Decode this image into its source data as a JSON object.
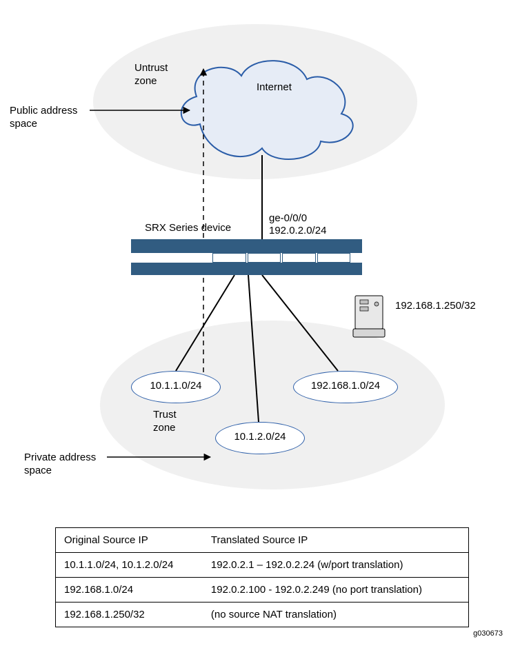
{
  "labels": {
    "public_addr_space": "Public address\nspace",
    "private_addr_space": "Private address\nspace",
    "untrust_zone": "Untrust\nzone",
    "trust_zone": "Trust\nzone",
    "internet": "Internet",
    "srx_device": "SRX Series device",
    "iface_name": "ge-0/0/0",
    "iface_addr": "192.0.2.0/24",
    "server_addr": "192.168.1.250/32"
  },
  "subnets": {
    "left": "10.1.1.0/24",
    "mid": "10.1.2.0/24",
    "right": "192.168.1.0/24"
  },
  "table": {
    "headers": {
      "orig": "Original Source IP",
      "trans": "Translated Source IP"
    },
    "rows": [
      {
        "orig": "10.1.1.0/24,  10.1.2.0/24",
        "trans": "192.0.2.1 – 192.0.2.24 (w/port translation)"
      },
      {
        "orig": "192.168.1.0/24",
        "trans": "192.0.2.100 - 192.0.2.249 (no port translation)"
      },
      {
        "orig": "192.168.1.250/32",
        "trans": "(no source NAT translation)"
      }
    ]
  },
  "image_id": "g030673"
}
